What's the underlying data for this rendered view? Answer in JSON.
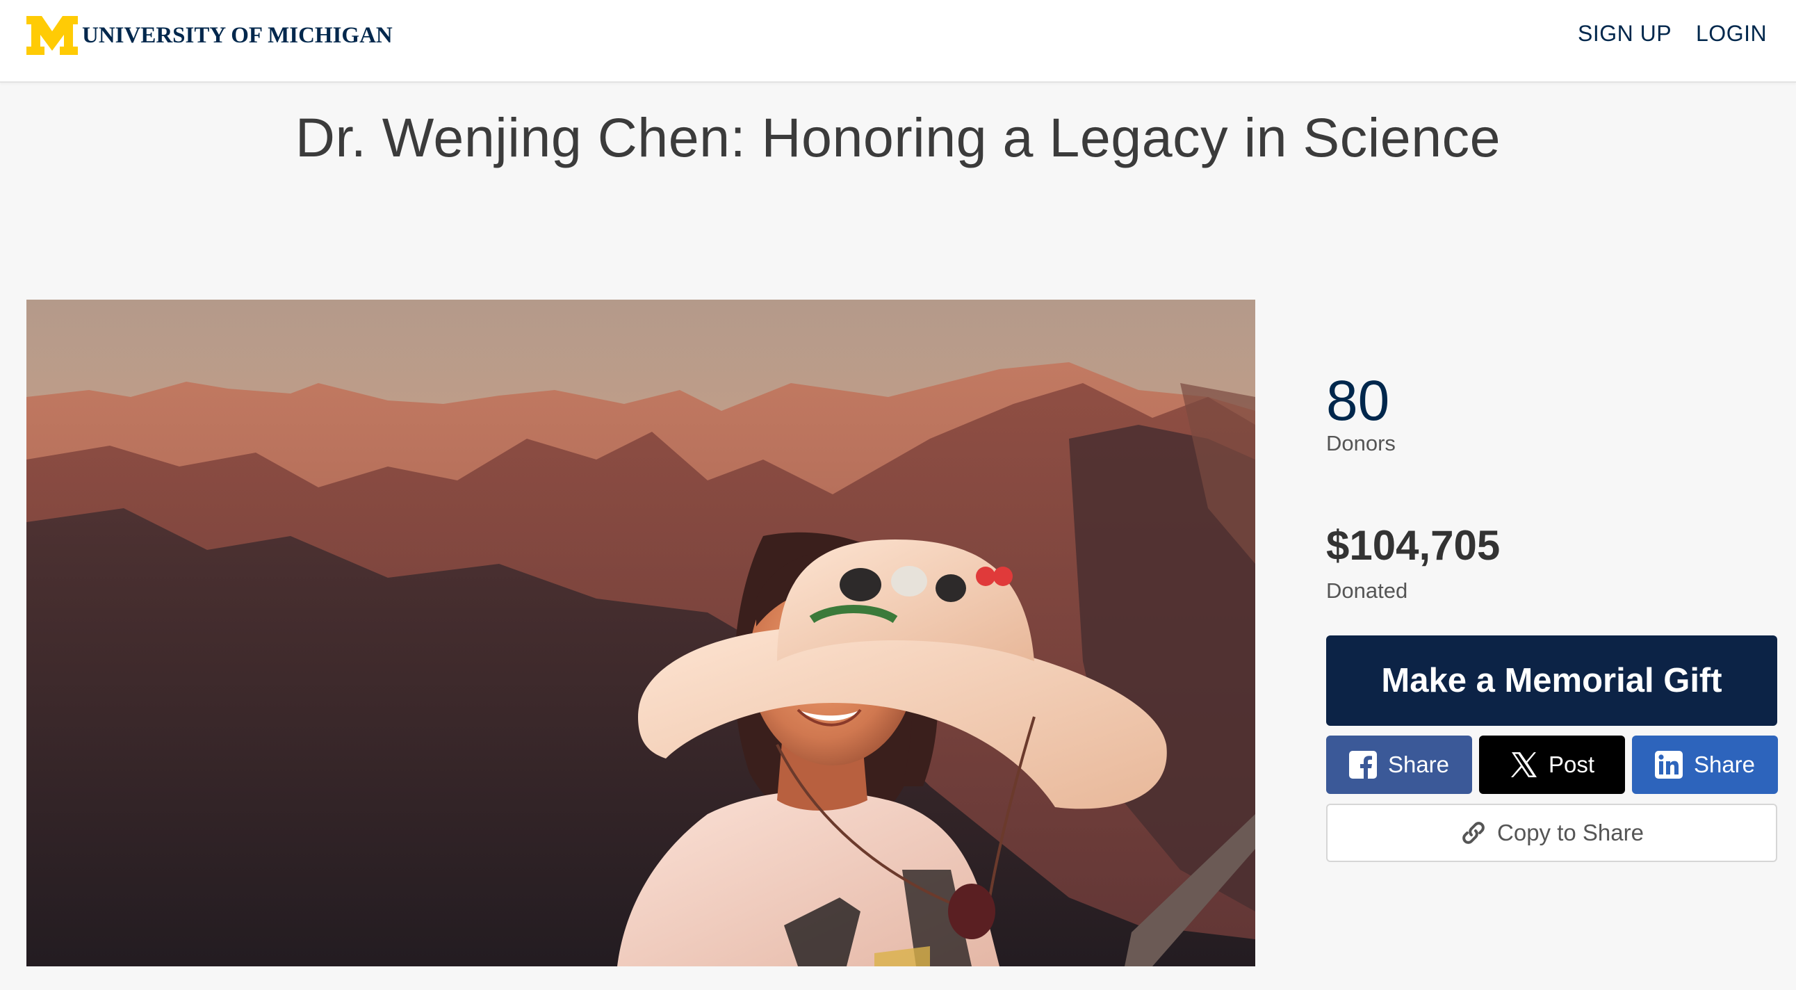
{
  "header": {
    "logo_letter": "M",
    "brand_name": "UNIVERSITY OF MICHIGAN",
    "nav": {
      "signup": "SIGN UP",
      "login": "LOGIN"
    },
    "colors": {
      "maize": "#ffcb05",
      "blue": "#00274c"
    }
  },
  "page": {
    "title": "Dr. Wenjing Chen: Honoring a Legacy in Science"
  },
  "hero": {
    "image_subject": "portrait photo at sunset in the mountains"
  },
  "stats": {
    "donors_value": "80",
    "donors_label": "Donors",
    "amount_value": "$104,705",
    "amount_label": "Donated"
  },
  "actions": {
    "gift_label": "Make a Memorial Gift",
    "facebook_label": "Share",
    "x_label": "Post",
    "linkedin_label": "Share",
    "copy_label": "Copy to Share",
    "icons": [
      "facebook-icon",
      "x-icon",
      "linkedin-icon",
      "link-icon"
    ],
    "colors": {
      "gift": "#0c2346",
      "facebook": "#3b5998",
      "x": "#000000",
      "linkedin": "#2d64bc"
    }
  }
}
